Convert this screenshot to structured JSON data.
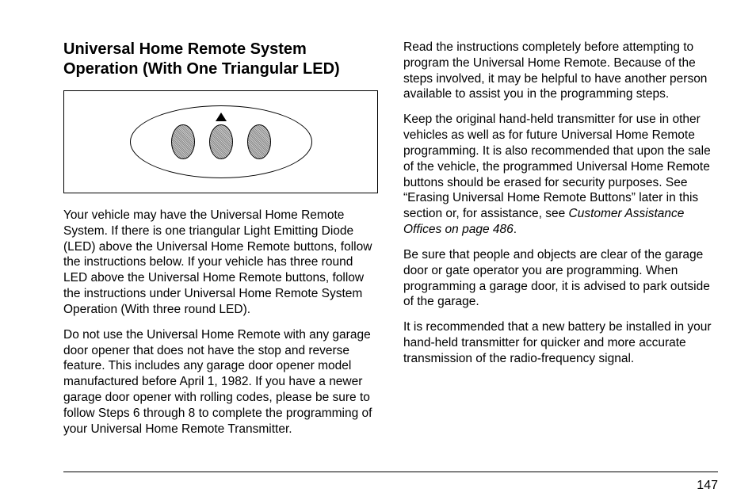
{
  "heading": "Universal Home Remote System Operation (With One Triangular LED)",
  "left": {
    "p1": "Your vehicle may have the Universal Home Remote System. If there is one triangular Light Emitting Diode (LED) above the Universal Home Remote buttons, follow the instructions below. If your vehicle has three round LED above the Universal Home Remote buttons, follow the instructions under Universal Home Remote System Operation (With three round LED).",
    "p2": "Do not use the Universal Home Remote with any garage door opener that does not have the stop and reverse feature. This includes any garage door opener model manufactured before April 1, 1982. If you have a newer garage door opener with rolling codes, please be sure to follow Steps 6 through 8 to complete the programming of your Universal Home Remote Transmitter."
  },
  "right": {
    "p1": "Read the instructions completely before attempting to program the Universal Home Remote. Because of the steps involved, it may be helpful to have another person available to assist you in the programming steps.",
    "p2a": "Keep the original hand-held transmitter for use in other vehicles as well as for future Universal Home Remote programming. It is also recommended that upon the sale of the vehicle, the programmed Universal Home Remote buttons should be erased for security purposes. See “Erasing Universal Home Remote Buttons” later in this section or, for assistance, see ",
    "p2_italic": "Customer Assistance Offices on page 486",
    "p2b": ".",
    "p3": "Be sure that people and objects are clear of the garage door or gate operator you are programming. When programming a garage door, it is advised to park outside of the garage.",
    "p4": "It is recommended that a new battery be installed in your hand-held transmitter for quicker and more accurate transmission of the radio-frequency signal."
  },
  "page_number": "147"
}
